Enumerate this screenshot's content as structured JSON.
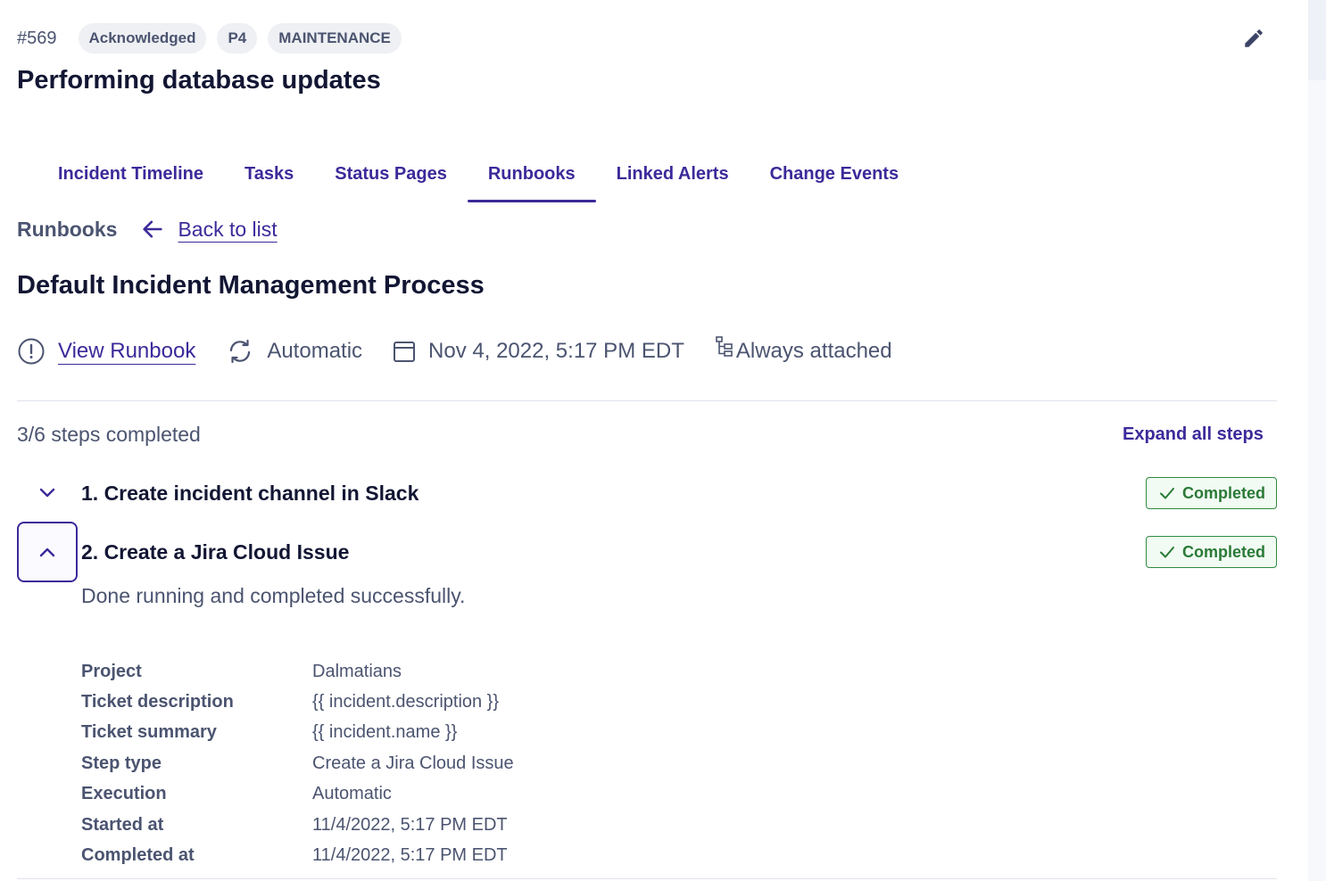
{
  "header": {
    "incident_id": "#569",
    "badges": [
      "Acknowledged",
      "P4",
      "MAINTENANCE"
    ],
    "edit_icon": "pencil-icon",
    "title": "Performing database updates"
  },
  "tabs": [
    {
      "label": "Incident Timeline",
      "active": false
    },
    {
      "label": "Tasks",
      "active": false
    },
    {
      "label": "Status Pages",
      "active": false
    },
    {
      "label": "Runbooks",
      "active": true
    },
    {
      "label": "Linked Alerts",
      "active": false
    },
    {
      "label": "Change Events",
      "active": false
    }
  ],
  "breadcrumb": {
    "label": "Runbooks",
    "back_icon": "arrow-left-icon",
    "back_link": "Back to list"
  },
  "runbook": {
    "title": "Default Incident Management Process",
    "view_link": "View Runbook",
    "trigger": "Automatic",
    "date": "Nov 4, 2022, 5:17 PM EDT",
    "attachment": "Always attached"
  },
  "steps": {
    "progress": "3/6 steps completed",
    "expand_all": "Expand all steps",
    "items": [
      {
        "name": "1. Create incident channel in Slack",
        "status": "Completed",
        "expanded": false
      },
      {
        "name": "2. Create a Jira Cloud Issue",
        "status": "Completed",
        "expanded": true
      }
    ],
    "expanded_description": "Done running and completed successfully.",
    "details": [
      {
        "key": "Project",
        "value": "Dalmatians"
      },
      {
        "key": "Ticket description",
        "value": "{{ incident.description }}"
      },
      {
        "key": "Ticket summary",
        "value": "{{ incident.name }}"
      },
      {
        "key": "Step type",
        "value": "Create a Jira Cloud Issue"
      },
      {
        "key": "Execution",
        "value": "Automatic"
      },
      {
        "key": "Started at",
        "value": "11/4/2022, 5:17 PM EDT"
      },
      {
        "key": "Completed at",
        "value": "11/4/2022, 5:17 PM EDT"
      }
    ]
  },
  "colors": {
    "accent": "#3b2a9a",
    "success": "#2f8a3e",
    "text_muted": "#4b5470"
  }
}
